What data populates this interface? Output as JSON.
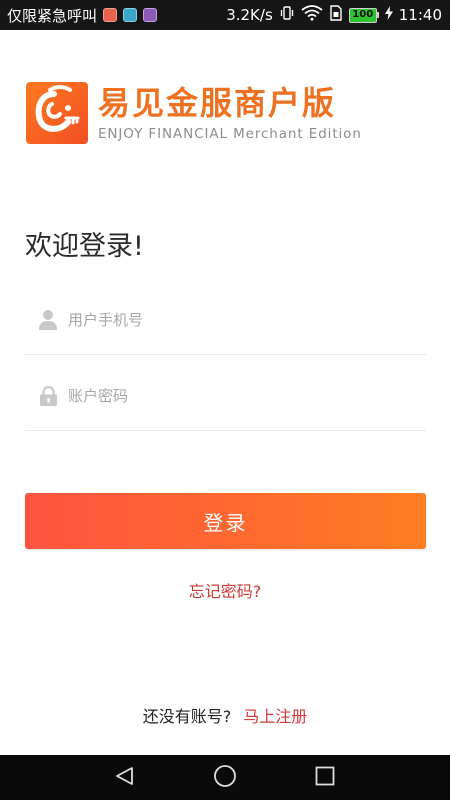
{
  "status_bar": {
    "carrier": "仅限紧急呼叫",
    "speed": "3.2K/s",
    "battery": "100",
    "time": "11:40",
    "icons": [
      "notification-app-icon",
      "notification-image-icon",
      "notification-gallery-icon",
      "vibrate-icon",
      "wifi-icon",
      "sim-icon",
      "battery-icon",
      "charging-icon"
    ],
    "colors": {
      "app1": "#e8634e",
      "app2": "#3aa6c8",
      "app3": "#8e5ab8"
    }
  },
  "brand": {
    "name": "易见金服商户版",
    "subtitle": "ENJOY FINANCIAL Merchant Edition",
    "logo_icon": "logo-mark-icon",
    "accent": "#ee7122"
  },
  "login": {
    "title": "欢迎登录!",
    "phone_placeholder": "用户手机号",
    "phone_value": "",
    "password_placeholder": "账户密码",
    "password_value": "",
    "submit_label": "登录",
    "forgot_label": "忘记密码?",
    "no_account_label": "还没有账号?",
    "register_label": "马上注册",
    "link_color": "#d03a36"
  },
  "nav_bar": {
    "buttons": [
      "back-icon",
      "home-icon",
      "recents-icon"
    ]
  }
}
